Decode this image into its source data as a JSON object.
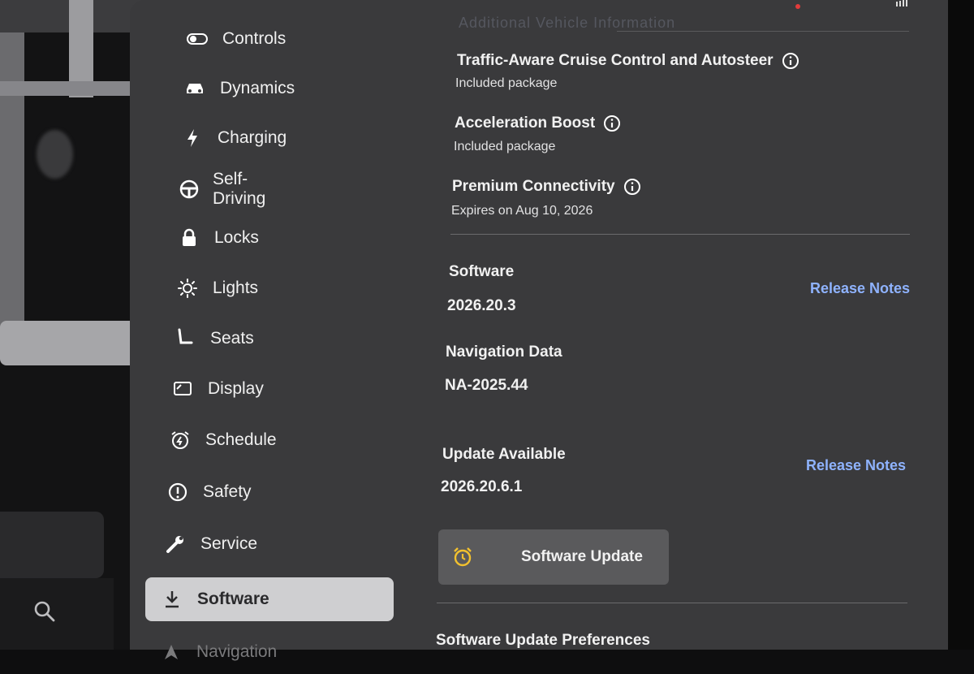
{
  "sidebar": {
    "items": [
      {
        "label": "Controls",
        "icon": "toggle-icon"
      },
      {
        "label": "Dynamics",
        "icon": "car-icon"
      },
      {
        "label": "Charging",
        "icon": "lightning-icon"
      },
      {
        "label": "Self-Driving",
        "icon": "steering-wheel-icon"
      },
      {
        "label": "Locks",
        "icon": "lock-icon"
      },
      {
        "label": "Lights",
        "icon": "sun-icon"
      },
      {
        "label": "Seats",
        "icon": "seat-icon"
      },
      {
        "label": "Display",
        "icon": "display-icon"
      },
      {
        "label": "Schedule",
        "icon": "alarm-clock-icon"
      },
      {
        "label": "Safety",
        "icon": "alert-circle-icon"
      },
      {
        "label": "Service",
        "icon": "wrench-icon"
      },
      {
        "label": "Software",
        "icon": "download-icon",
        "active": true
      },
      {
        "label": "Navigation",
        "icon": "navigation-arrow-icon"
      }
    ]
  },
  "content": {
    "faded_header": "Additional Vehicle Information",
    "features": [
      {
        "title": "Traffic-Aware Cruise Control and Autosteer",
        "subtitle": "Included package"
      },
      {
        "title": "Acceleration Boost",
        "subtitle": "Included package"
      },
      {
        "title": "Premium Connectivity",
        "subtitle": "Expires on Aug 10, 2026"
      }
    ],
    "software": {
      "label": "Software",
      "value": "2026.20.3",
      "link": "Release Notes"
    },
    "navigation_data": {
      "label": "Navigation Data",
      "value": "NA-2025.44"
    },
    "update": {
      "label": "Update Available",
      "value": "2026.20.6.1",
      "link": "Release Notes"
    },
    "update_button": {
      "label": "Software Update"
    },
    "preferences_title": "Software Update Preferences"
  },
  "colors": {
    "panel": "#3a3a3c",
    "link": "#8fb3ff",
    "active_nav": "#cfcfd1",
    "alarm": "#f2c12e"
  }
}
